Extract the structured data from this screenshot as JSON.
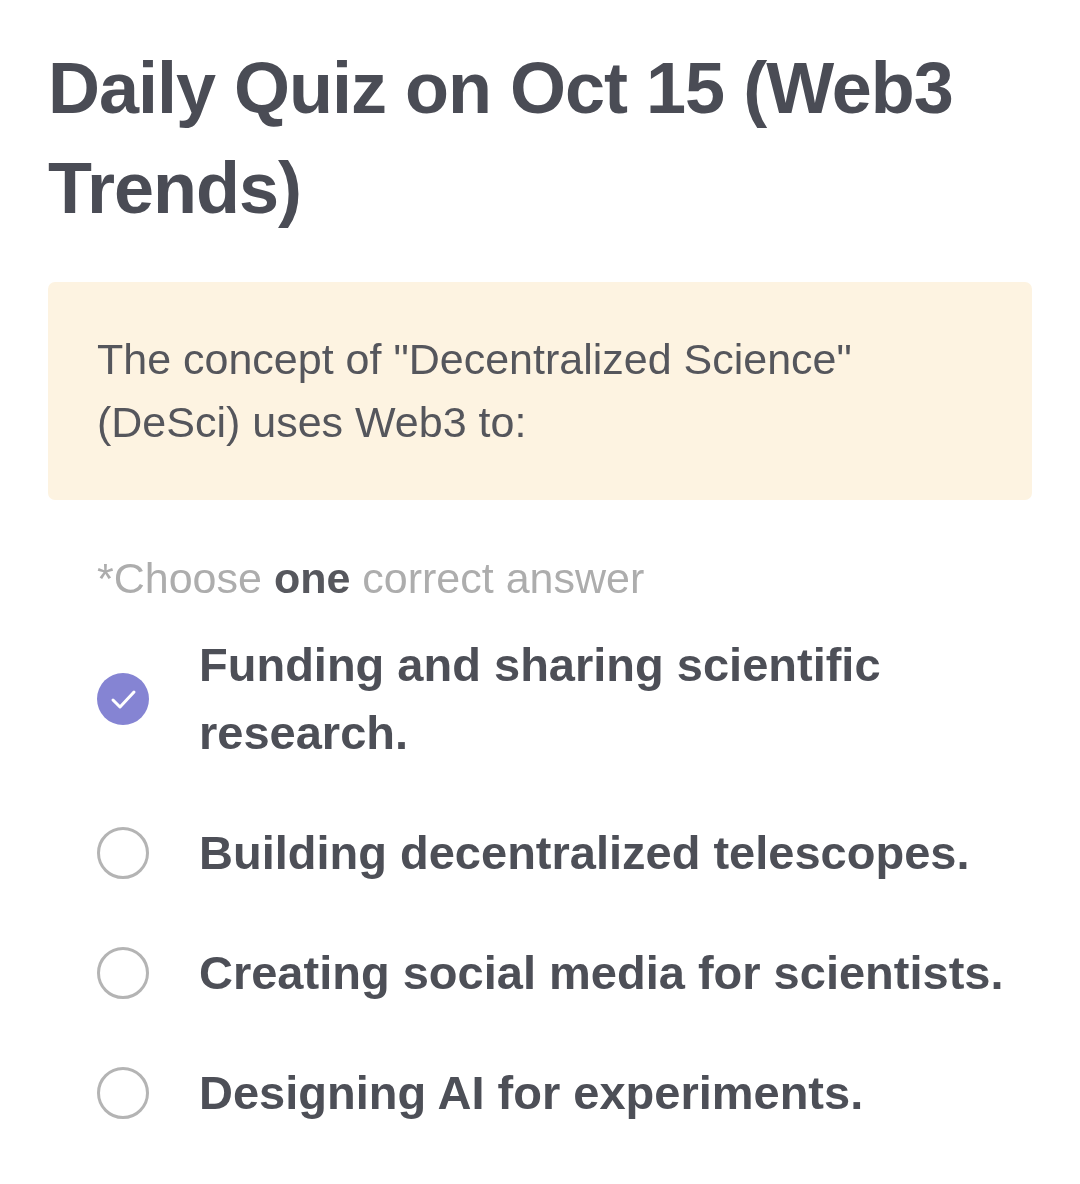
{
  "title": "Daily Quiz on Oct 15 (Web3 Trends)",
  "question": "The concept of \"Decentralized Science\" (DeSci) uses Web3 to:",
  "instruction": "*Choose **one** correct answer",
  "options": [
    {
      "label": "Funding and sharing scientific research.",
      "selected": true
    },
    {
      "label": "Building decentralized telescopes.",
      "selected": false
    },
    {
      "label": "Creating social media for scientists.",
      "selected": false
    },
    {
      "label": "Designing AI for experiments.",
      "selected": false
    }
  ]
}
